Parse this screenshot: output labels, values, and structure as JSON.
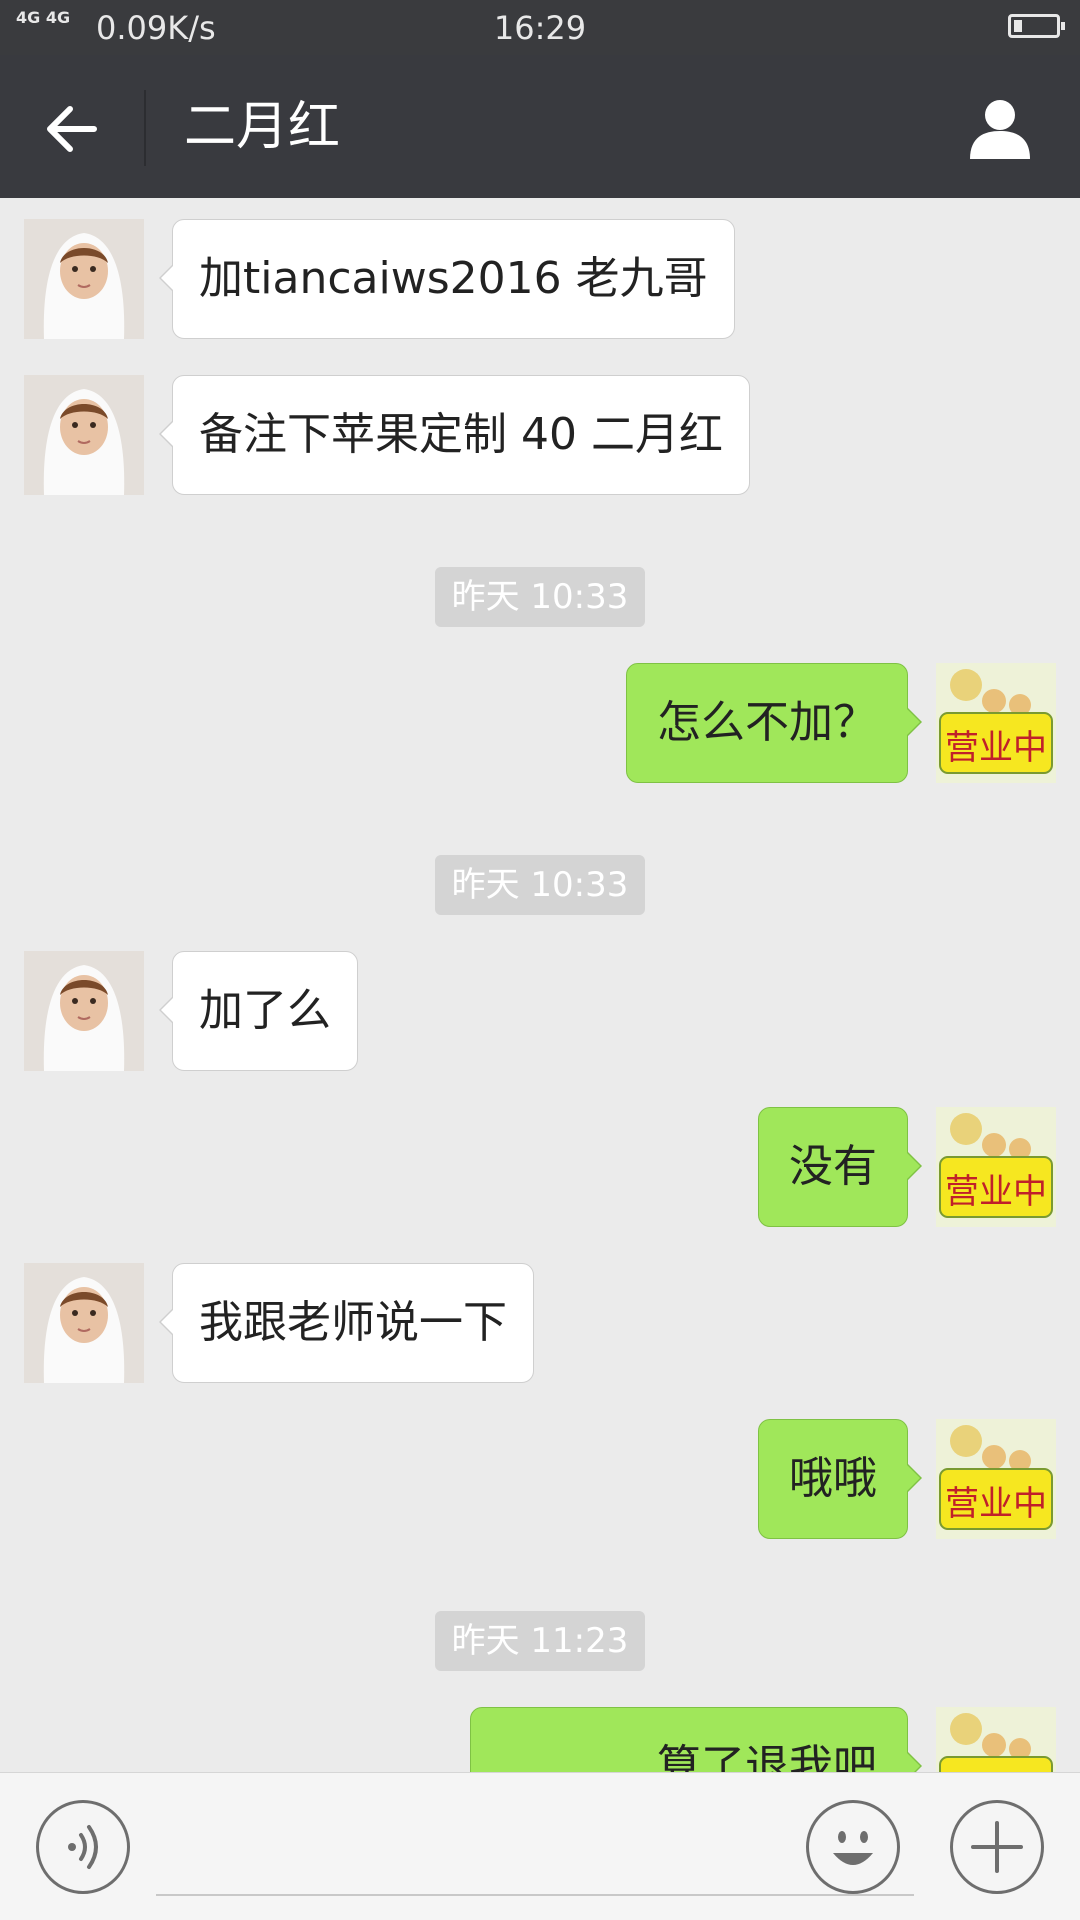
{
  "status_bar": {
    "signal_text": "4G 4G",
    "net_speed": "0.09K/s",
    "time": "16:29",
    "battery_level": 0.2
  },
  "header": {
    "back_icon": "arrow-left-icon",
    "title": "二月红",
    "profile_icon": "person-icon"
  },
  "messages": [
    {
      "type": "in",
      "text": "加tiancaiws2016  老九哥"
    },
    {
      "type": "in",
      "text": "备注下苹果定制 40 二月红"
    },
    {
      "type": "time",
      "text": "昨天 10:33"
    },
    {
      "type": "out",
      "text": "怎么不加？"
    },
    {
      "type": "time",
      "text": "昨天 10:33"
    },
    {
      "type": "in",
      "text": "加了么"
    },
    {
      "type": "out",
      "text": "没有"
    },
    {
      "type": "in",
      "text": "我跟老师说一下"
    },
    {
      "type": "out",
      "text": "哦哦"
    },
    {
      "type": "time",
      "text": "昨天 11:23"
    },
    {
      "type": "out",
      "text": "算了退我吧"
    }
  ],
  "avatars": {
    "contact_sign_text": "",
    "self_sign_text": "营业中"
  },
  "input_bar": {
    "voice_icon": "voice-icon",
    "input_value": "",
    "emoji_icon": "smiley-icon",
    "plus_icon": "plus-icon"
  },
  "colors": {
    "header_bg": "#393a3f",
    "chat_bg": "#ebebeb",
    "outgoing_bubble": "#a0e75a",
    "incoming_bubble": "#ffffff"
  }
}
